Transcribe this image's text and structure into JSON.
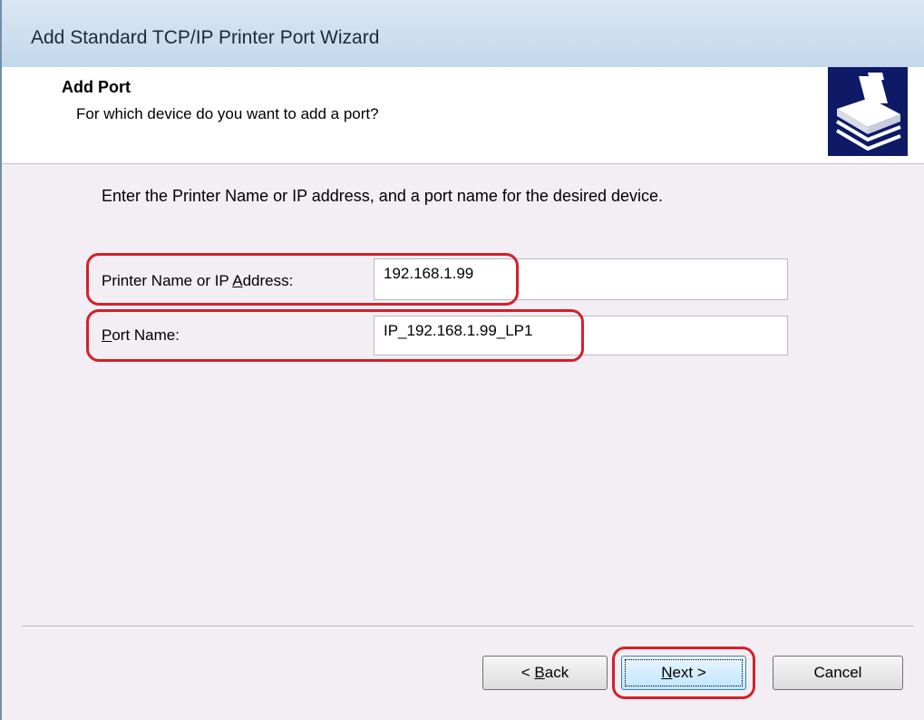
{
  "window": {
    "title": "Add Standard TCP/IP Printer Port Wizard"
  },
  "header": {
    "title": "Add Port",
    "subtitle": "For which device do you want to add a port?",
    "icon": "printer-icon"
  },
  "body": {
    "instruction": "Enter the Printer Name or IP address, and a port name for the desired device.",
    "fields": [
      {
        "label_pre": "Printer Name or IP ",
        "label_access": "A",
        "label_post": "ddress:",
        "value": "192.168.1.99"
      },
      {
        "label_pre": "",
        "label_access": "P",
        "label_post": "ort Name:",
        "value": "IP_192.168.1.99_LP1"
      }
    ]
  },
  "footer": {
    "back": {
      "prefix": "< ",
      "access": "B",
      "rest": "ack"
    },
    "next": {
      "access": "N",
      "rest": "ext >"
    },
    "cancel": "Cancel"
  },
  "highlight_color": "#d4202a"
}
